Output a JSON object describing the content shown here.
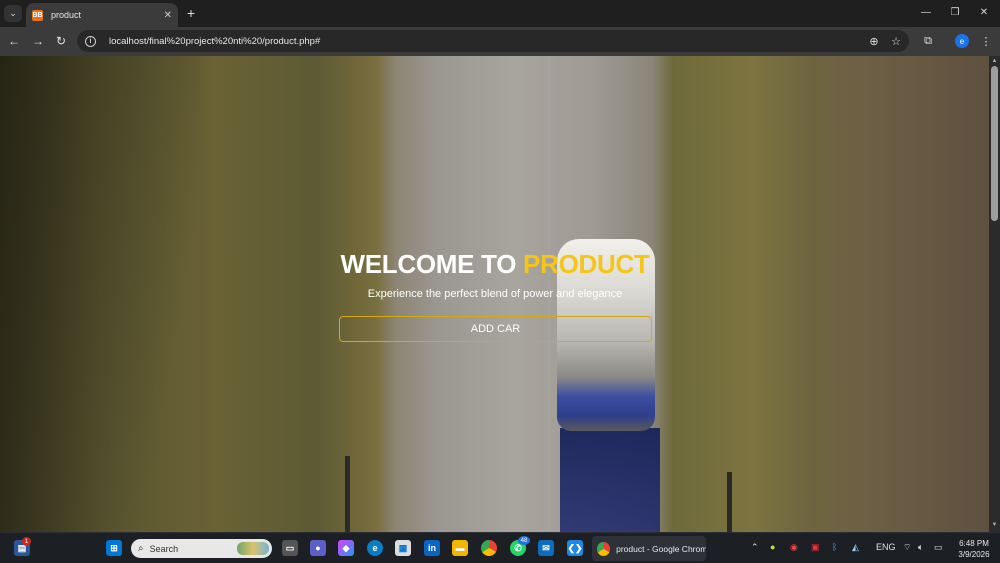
{
  "browser": {
    "tab_title": "product",
    "favicon_text": "BB",
    "url": "localhost/final%20project%20nti%20/product.php#",
    "profile_initial": "e"
  },
  "hero": {
    "title_main": "WELCOME TO ",
    "title_accent": "PRODUCT",
    "subtitle": "Experience the perfect blend of power and elegance",
    "add_button_label": "ADD CAR",
    "accent_color": "#f5c518"
  },
  "taskbar": {
    "search_label": "Search",
    "active_app_label": "product - Google Chrome",
    "whatsapp_badge": "48",
    "widget_badge": "1",
    "language": "ENG",
    "time": "6:48 PM",
    "date": "3/9/2026"
  }
}
